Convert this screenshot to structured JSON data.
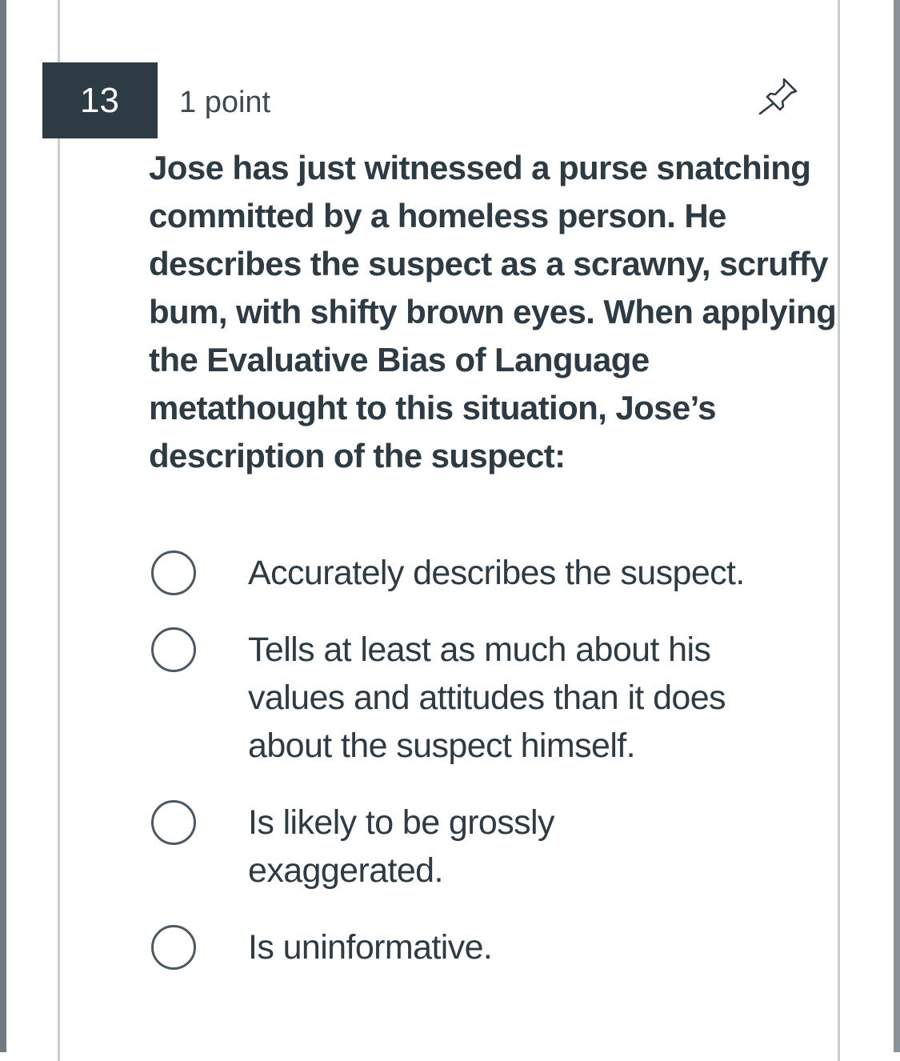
{
  "question": {
    "number": "13",
    "points": "1 point",
    "text": "Jose has just witnessed a purse snatching committed by a homeless person. He describes the suspect as a scrawny, scruffy bum, with shifty brown eyes. When applying the Evaluative Bias of Language metathought to this situation, Jose’s description of the suspect:",
    "pin_icon": "pushpin-icon"
  },
  "answers": [
    {
      "text": "Accurately describes the suspect.",
      "selected": false
    },
    {
      "text": "Tells at least as much about his\nvalues and attitudes than it does\nabout the suspect himself.",
      "selected": false
    },
    {
      "text": "Is likely to be grossly\nexaggerated.",
      "selected": false
    },
    {
      "text": "Is uninformative.",
      "selected": false
    }
  ]
}
